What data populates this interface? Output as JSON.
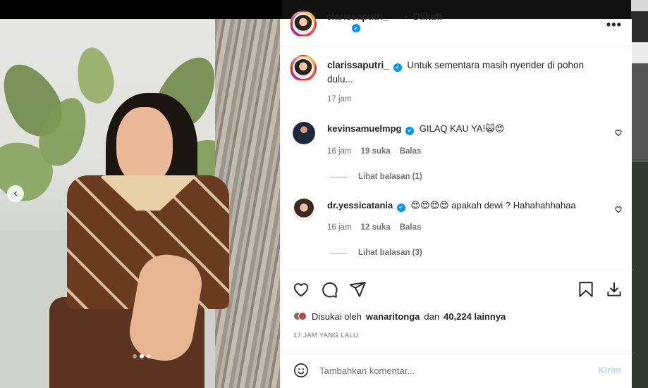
{
  "post": {
    "author": "clarissaputri_",
    "follow_separator": "•",
    "follow_status": "Diikuti",
    "verified_glyph": "✔",
    "more_glyph": "•••",
    "caption": "Untuk sementara masih nyender di pohon dulu...",
    "caption_time": "17 jam"
  },
  "comments": [
    {
      "username": "kevinsamuelmpg",
      "text": "GILAQ KAU YA!🙀😍",
      "time": "16 jam",
      "likes": "19 suka",
      "reply": "Balas",
      "view_replies": "Lihat balasan (1)"
    },
    {
      "username": "dr.yessicatania",
      "text": "😍😍😍😍 apakah dewi ? Hahahahhahaa",
      "time": "16 jam",
      "likes": "12 suka",
      "reply": "Balas",
      "view_replies": "Lihat balasan (3)"
    }
  ],
  "likes": {
    "prefix": "Disukai oleh",
    "user": "wanaritonga",
    "connector": "dan",
    "others": "40,224 lainnya"
  },
  "timeago": "17 JAM YANG LALU",
  "add_comment": {
    "placeholder": "Tambahkan komentar...",
    "post_label": "Kirim"
  },
  "carousel": {
    "prev_glyph": "‹",
    "total_slides": 3,
    "active_slide": 2
  },
  "colors": {
    "verified": "#0095f6",
    "post_disabled": "#b3dbff",
    "muted": "#737373"
  }
}
